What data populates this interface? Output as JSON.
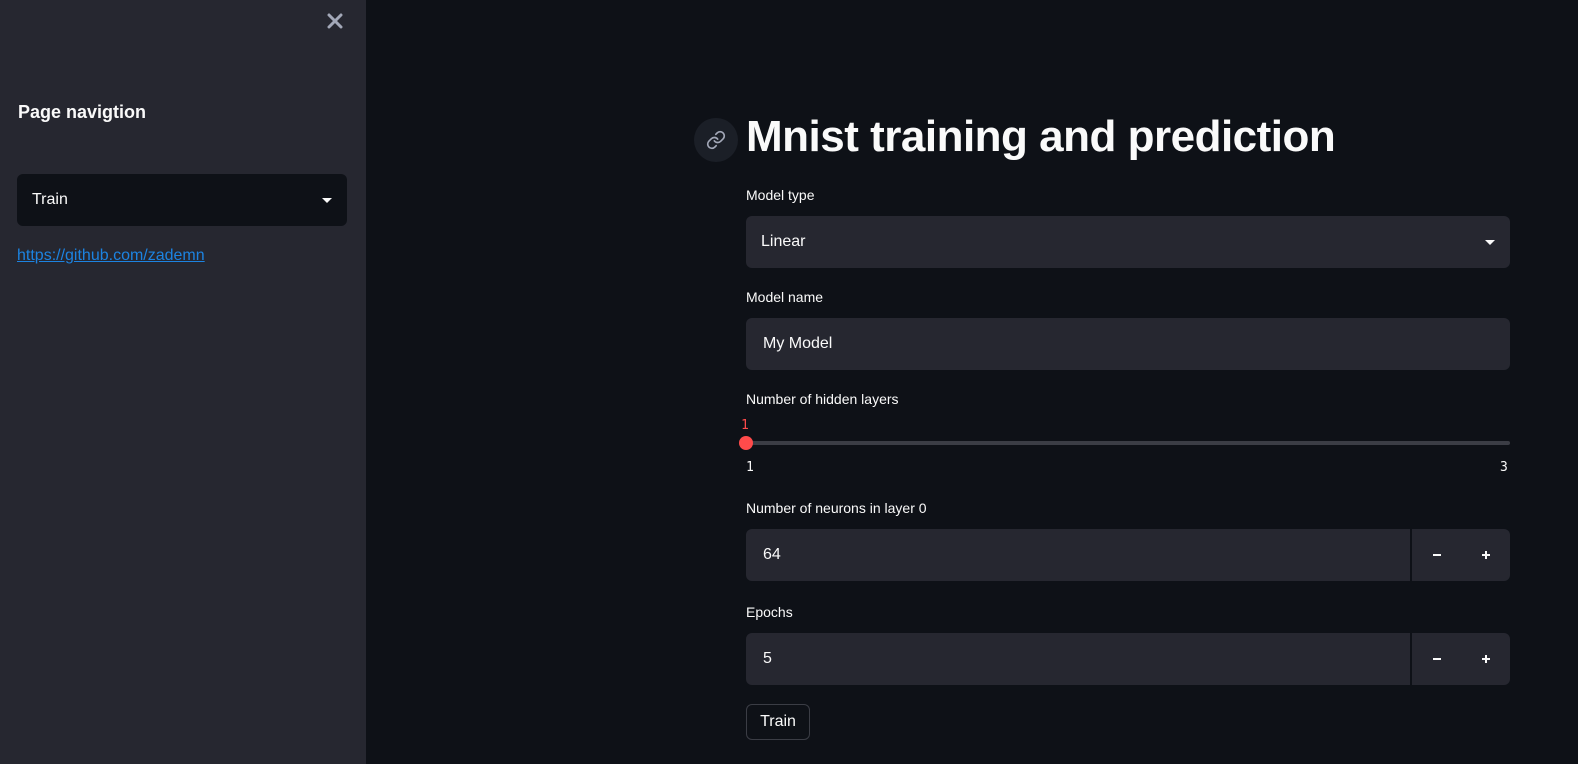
{
  "sidebar": {
    "title": "Page navigtion",
    "page_select": {
      "value": "Train"
    },
    "link_text": "https://github.com/zademn"
  },
  "main": {
    "title": "Mnist training and prediction",
    "model_type": {
      "label": "Model type",
      "value": "Linear"
    },
    "model_name": {
      "label": "Model name",
      "value": "My Model"
    },
    "hidden_layers": {
      "label": "Number of hidden layers",
      "value": "1",
      "min": "1",
      "max": "3"
    },
    "neurons": {
      "label": "Number of neurons in layer 0",
      "value": "64"
    },
    "epochs": {
      "label": "Epochs",
      "value": "5"
    },
    "train_button": "Train"
  },
  "colors": {
    "accent": "#ff4b4b",
    "link": "#1c83e1",
    "background": "#0e1117",
    "sidebar": "#262730"
  }
}
